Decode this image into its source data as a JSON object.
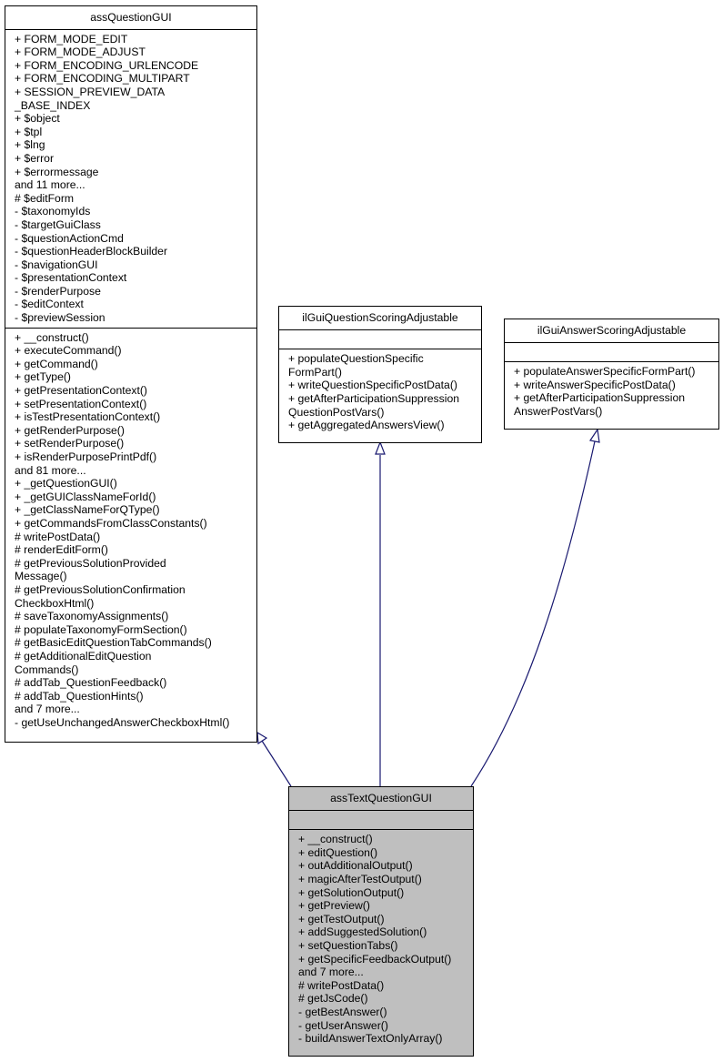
{
  "diagram": {
    "type": "uml-class-inheritance",
    "edge_color": "#191970",
    "classes": {
      "assQuestionGUI": {
        "name": "assQuestionGUI",
        "attributes": [
          "+ FORM_MODE_EDIT",
          "+ FORM_MODE_ADJUST",
          "+ FORM_ENCODING_URLENCODE",
          "+ FORM_ENCODING_MULTIPART",
          "+ SESSION_PREVIEW_DATA",
          "_BASE_INDEX",
          "+ $object",
          "+ $tpl",
          "+ $lng",
          "+ $error",
          "+ $errormessage",
          "and 11 more...",
          "# $editForm",
          "- $taxonomyIds",
          "- $targetGuiClass",
          "- $questionActionCmd",
          "- $questionHeaderBlockBuilder",
          "- $navigationGUI",
          "- $presentationContext",
          "- $renderPurpose",
          "- $editContext",
          "- $previewSession"
        ],
        "methods": [
          "+ __construct()",
          "+ executeCommand()",
          "+ getCommand()",
          "+ getType()",
          "+ getPresentationContext()",
          "+ setPresentationContext()",
          "+ isTestPresentationContext()",
          "+ getRenderPurpose()",
          "+ setRenderPurpose()",
          "+ isRenderPurposePrintPdf()",
          "and 81 more...",
          "+ _getQuestionGUI()",
          "+ _getGUIClassNameForId()",
          "+ _getClassNameForQType()",
          "+ getCommandsFromClassConstants()",
          "# writePostData()",
          "# renderEditForm()",
          "# getPreviousSolutionProvided",
          "Message()",
          "# getPreviousSolutionConfirmation",
          "CheckboxHtml()",
          "# saveTaxonomyAssignments()",
          "# populateTaxonomyFormSection()",
          "# getBasicEditQuestionTabCommands()",
          "# getAdditionalEditQuestion",
          "Commands()",
          "# addTab_QuestionFeedback()",
          "# addTab_QuestionHints()",
          "and 7 more...",
          "- getUseUnchangedAnswerCheckboxHtml()"
        ]
      },
      "ilGuiQuestionScoringAdjustable": {
        "name": "ilGuiQuestionScoringAdjustable",
        "attributes": [],
        "methods": [
          "+ populateQuestionSpecific",
          "FormPart()",
          "+ writeQuestionSpecificPostData()",
          "+ getAfterParticipationSuppression",
          "QuestionPostVars()",
          "+ getAggregatedAnswersView()"
        ]
      },
      "ilGuiAnswerScoringAdjustable": {
        "name": "ilGuiAnswerScoringAdjustable",
        "attributes": [],
        "methods": [
          "+ populateAnswerSpecificFormPart()",
          "+ writeAnswerSpecificPostData()",
          "+ getAfterParticipationSuppression",
          "AnswerPostVars()"
        ]
      },
      "assTextQuestionGUI": {
        "name": "assTextQuestionGUI",
        "attributes": [],
        "methods": [
          "+ __construct()",
          "+ editQuestion()",
          "+ outAdditionalOutput()",
          "+ magicAfterTestOutput()",
          "+ getSolutionOutput()",
          "+ getPreview()",
          "+ getTestOutput()",
          "+ addSuggestedSolution()",
          "+ setQuestionTabs()",
          "+ getSpecificFeedbackOutput()",
          "and 7 more...",
          "# writePostData()",
          "# getJsCode()",
          "- getBestAnswer()",
          "- getUserAnswer()",
          "- buildAnswerTextOnlyArray()"
        ]
      }
    },
    "edges": [
      {
        "from": "assTextQuestionGUI",
        "to": "assQuestionGUI",
        "kind": "inherits"
      },
      {
        "from": "assTextQuestionGUI",
        "to": "ilGuiQuestionScoringAdjustable",
        "kind": "implements"
      },
      {
        "from": "assTextQuestionGUI",
        "to": "ilGuiAnswerScoringAdjustable",
        "kind": "implements"
      }
    ]
  }
}
